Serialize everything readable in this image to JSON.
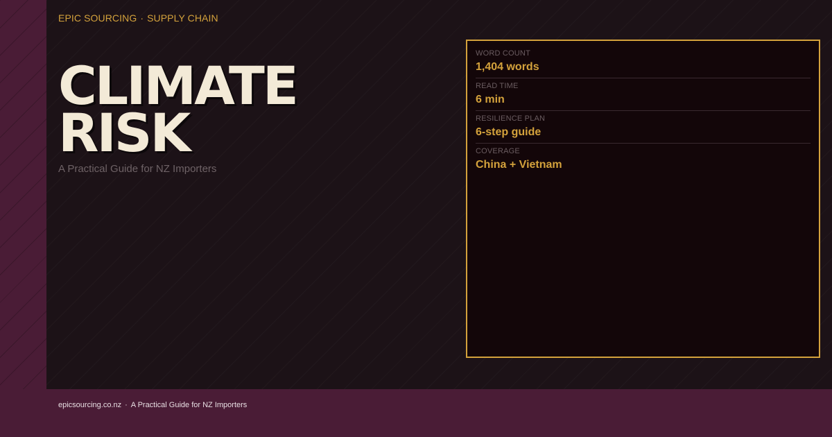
{
  "kicker": {
    "brand": "EPIC SOURCING",
    "separator": "·",
    "category": "SUPPLY CHAIN"
  },
  "title": {
    "line1": "CLIMATE",
    "line2": "RISK"
  },
  "subtitle": "A Practical Guide for NZ Importers",
  "stats": [
    {
      "label": "WORD COUNT",
      "value": "1,404 words"
    },
    {
      "label": "READ TIME",
      "value": "6 min"
    },
    {
      "label": "RESILIENCE PLAN",
      "value": "6-step guide"
    },
    {
      "label": "COVERAGE",
      "value": "China + Vietnam"
    }
  ],
  "footer": {
    "site": "epicsourcing.co.nz",
    "separator": "·",
    "tagline": "A Practical Guide for NZ Importers"
  },
  "colors": {
    "accent": "#d4a23c",
    "plum": "#4a1c36",
    "panel": "#1c1217",
    "title": "#f3ead7"
  }
}
